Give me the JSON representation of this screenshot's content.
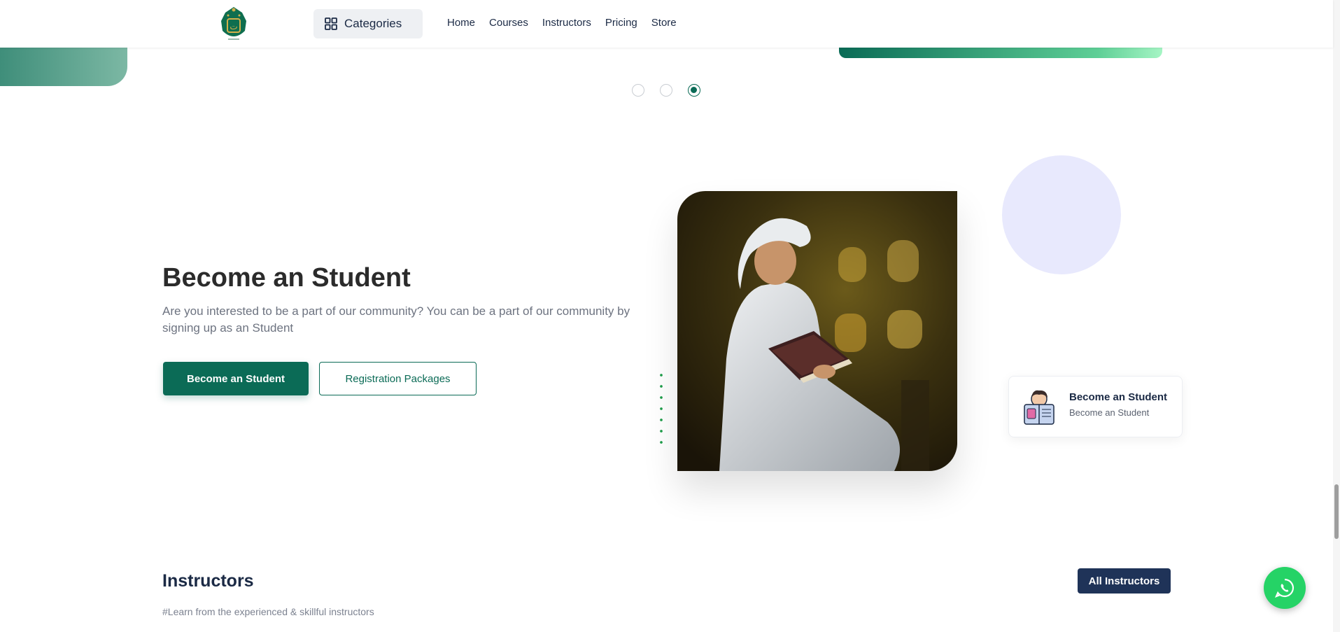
{
  "header": {
    "categories_label": "Categories",
    "nav": [
      "Home",
      "Courses",
      "Instructors",
      "Pricing",
      "Store"
    ]
  },
  "slider": {
    "dots": 3,
    "active_index": 2
  },
  "hero": {
    "title": "Become an Student",
    "description": "Are you interested to be a part of our community? You can be a part of our community by signing up as an Student",
    "primary_button": "Become an Student",
    "secondary_button": "Registration Packages"
  },
  "card": {
    "title": "Become an Student",
    "subtitle": "Become an Student"
  },
  "instructors": {
    "title": "Instructors",
    "subtitle": "#Learn from the experienced & skillful instructors",
    "button": "All Instructors"
  },
  "colors": {
    "brand_green": "#0b6b56",
    "navy": "#1f3358",
    "whatsapp": "#25d366"
  },
  "icons": [
    "categories-grid-icon",
    "whatsapp-icon",
    "reading-student-icon"
  ]
}
